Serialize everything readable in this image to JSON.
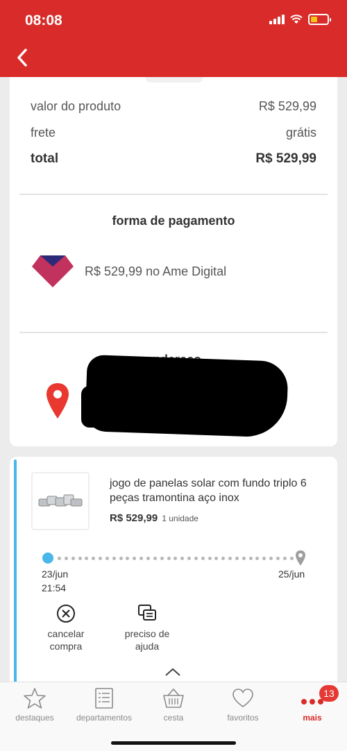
{
  "status": {
    "time": "08:08"
  },
  "summary": {
    "product_label": "valor do produto",
    "product_value": "R$ 529,99",
    "shipping_label": "frete",
    "shipping_value": "grátis",
    "total_label": "total",
    "total_value": "R$ 529,99"
  },
  "payment": {
    "title": "forma de pagamento",
    "text": "R$ 529,99 no Ame Digital"
  },
  "address": {
    "title": "endereço"
  },
  "order": {
    "product_name": "jogo de panelas solar com fundo triplo 6 peças tramontina aço inox",
    "price": "R$ 529,99",
    "quantity": "1 unidade",
    "start_date": "23/jun",
    "start_time": "21:54",
    "end_date": "25/jun",
    "cancel_label_1": "cancelar",
    "cancel_label_2": "compra",
    "help_label_1": "preciso de",
    "help_label_2": "ajuda"
  },
  "nav": {
    "items": [
      {
        "label": "destaques",
        "icon": "star-icon"
      },
      {
        "label": "departamentos",
        "icon": "list-icon"
      },
      {
        "label": "cesta",
        "icon": "basket-icon"
      },
      {
        "label": "favoritos",
        "icon": "heart-icon"
      },
      {
        "label": "mais",
        "icon": "more-icon",
        "badge": "13"
      }
    ]
  },
  "colors": {
    "brand": "#d92c2a",
    "accent": "#4ab7ea"
  }
}
